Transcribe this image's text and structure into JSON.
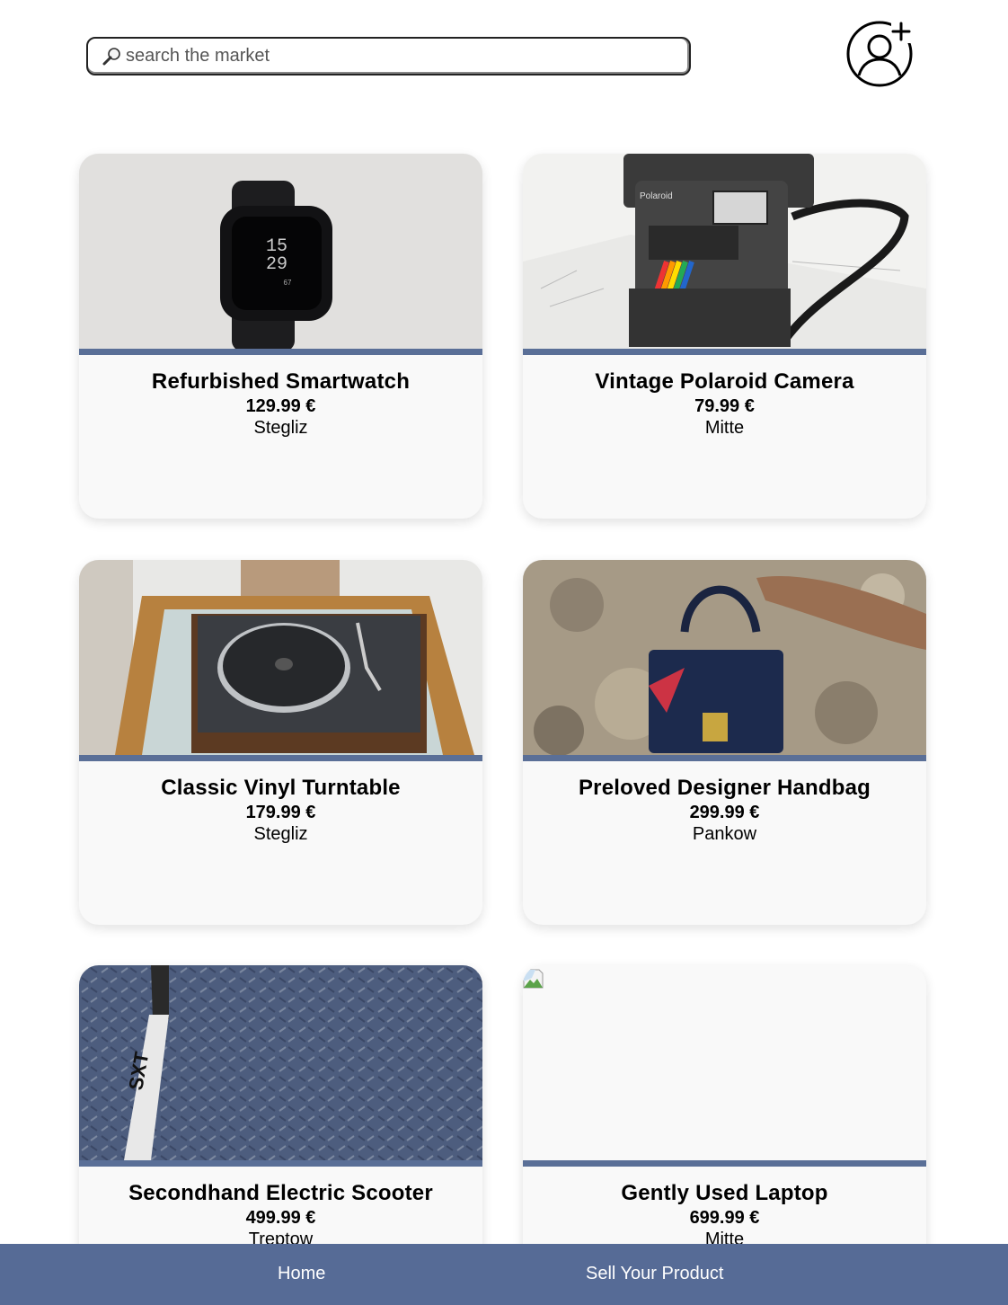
{
  "search": {
    "placeholder": "search the market",
    "icon": "magnifier-icon"
  },
  "header": {
    "account_icon": "add-user-icon"
  },
  "colors": {
    "accent": "#566b96",
    "card_bg": "#f9f9f9",
    "stripe": "#5a6f97"
  },
  "products": [
    {
      "title": "Refurbished Smartwatch",
      "price": "129.99 €",
      "location": "Stegliz"
    },
    {
      "title": "Vintage Polaroid Camera",
      "price": "79.99 €",
      "location": "Mitte"
    },
    {
      "title": "Classic Vinyl Turntable",
      "price": "179.99 €",
      "location": "Stegliz"
    },
    {
      "title": "Preloved Designer Handbag",
      "price": "299.99 €",
      "location": "Pankow"
    },
    {
      "title": "Secondhand Electric Scooter",
      "price": "499.99 €",
      "location": "Treptow"
    },
    {
      "title": "Gently Used Laptop",
      "price": "699.99 €",
      "location": "Mitte"
    }
  ],
  "nav": {
    "home_label": "Home",
    "sell_label": "Sell Your Product"
  }
}
